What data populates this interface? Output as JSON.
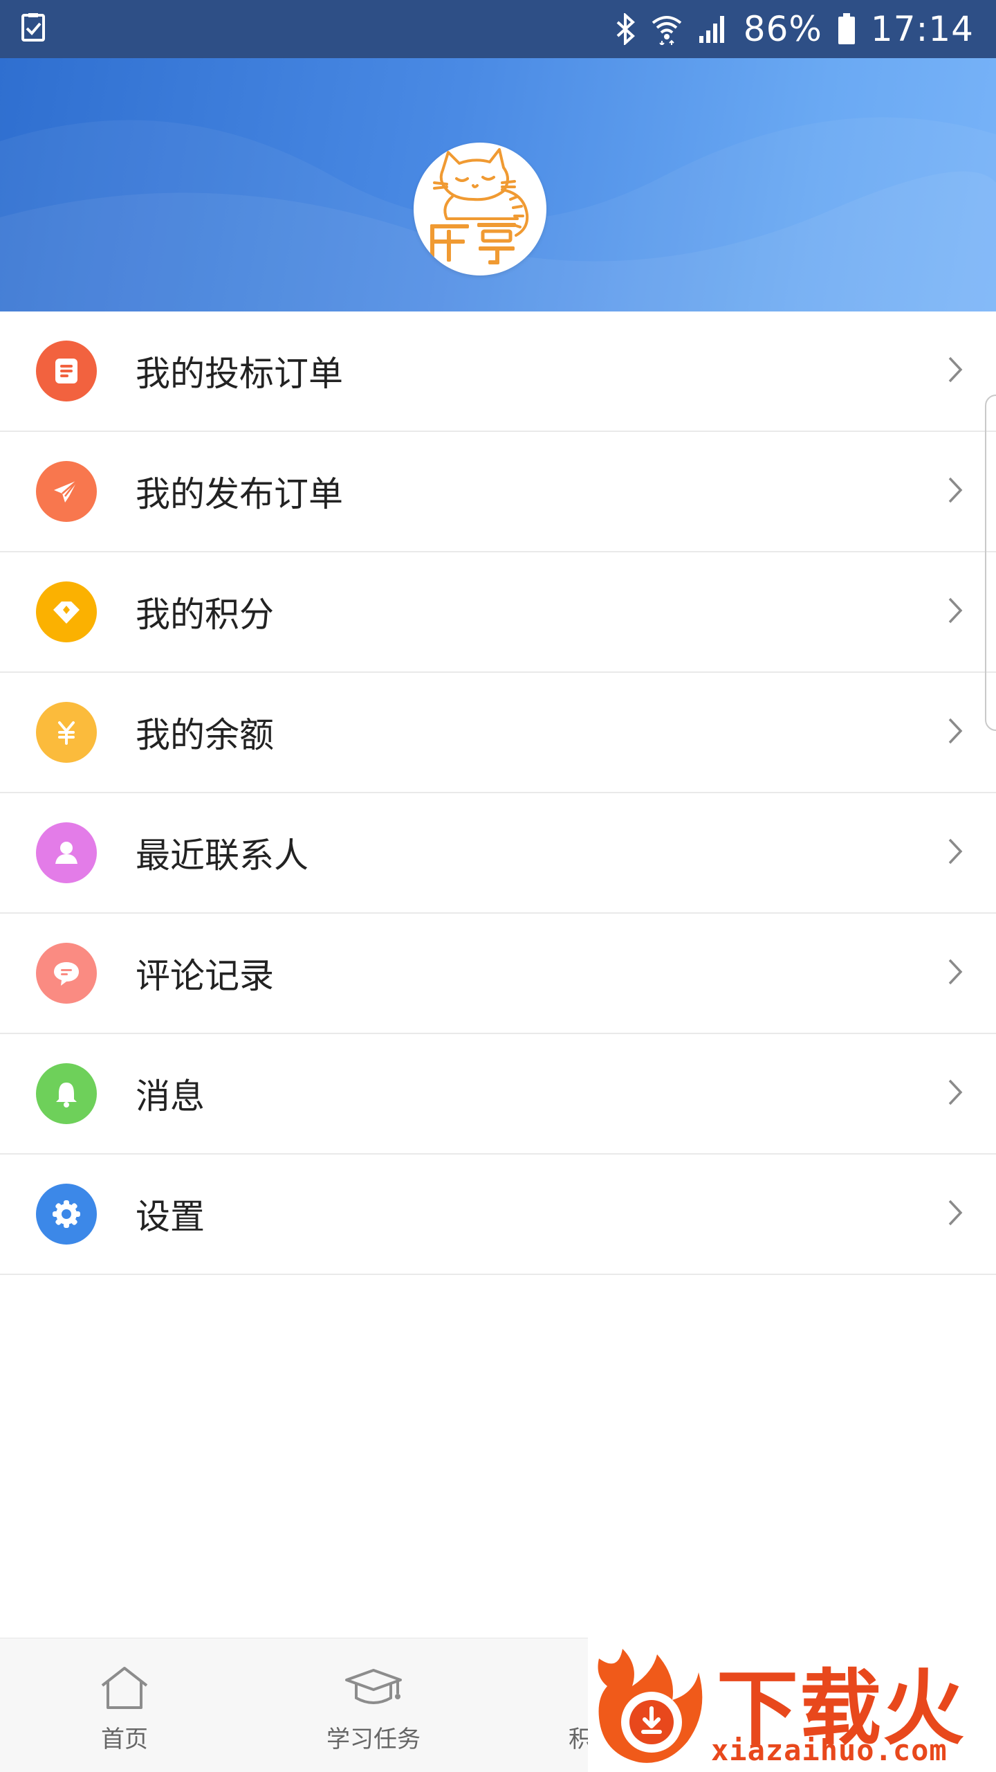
{
  "status_bar": {
    "battery_percent": "86%",
    "time": "17:14",
    "icons": [
      "task-check-icon",
      "bluetooth-icon",
      "wifi-icon",
      "cellular-signal-icon",
      "battery-icon"
    ]
  },
  "profile": {
    "avatar_logo_text": "乐享"
  },
  "menu": {
    "items": [
      {
        "label": "我的投标订单",
        "icon": "document-icon",
        "color": "#f2623f"
      },
      {
        "label": "我的发布订单",
        "icon": "paper-plane-icon",
        "color": "#f8774e"
      },
      {
        "label": "我的积分",
        "icon": "diamond-icon",
        "color": "#fbb101"
      },
      {
        "label": "我的余额",
        "icon": "yen-icon",
        "color": "#fbbb3c"
      },
      {
        "label": "最近联系人",
        "icon": "person-icon",
        "color": "#e37ce8"
      },
      {
        "label": "评论记录",
        "icon": "chat-bubble-icon",
        "color": "#fa8b82"
      },
      {
        "label": "消息",
        "icon": "bell-icon",
        "color": "#6ed05a"
      },
      {
        "label": "设置",
        "icon": "gear-icon",
        "color": "#3c88e8"
      }
    ]
  },
  "bottom_nav": {
    "items": [
      {
        "label": "首页",
        "icon": "home-icon"
      },
      {
        "label": "学习任务",
        "icon": "graduation-cap-icon"
      },
      {
        "label": "积分商城",
        "icon": "points-icon"
      }
    ]
  },
  "watermark": {
    "title": "下载火",
    "url": "xiazaihuo.com"
  }
}
